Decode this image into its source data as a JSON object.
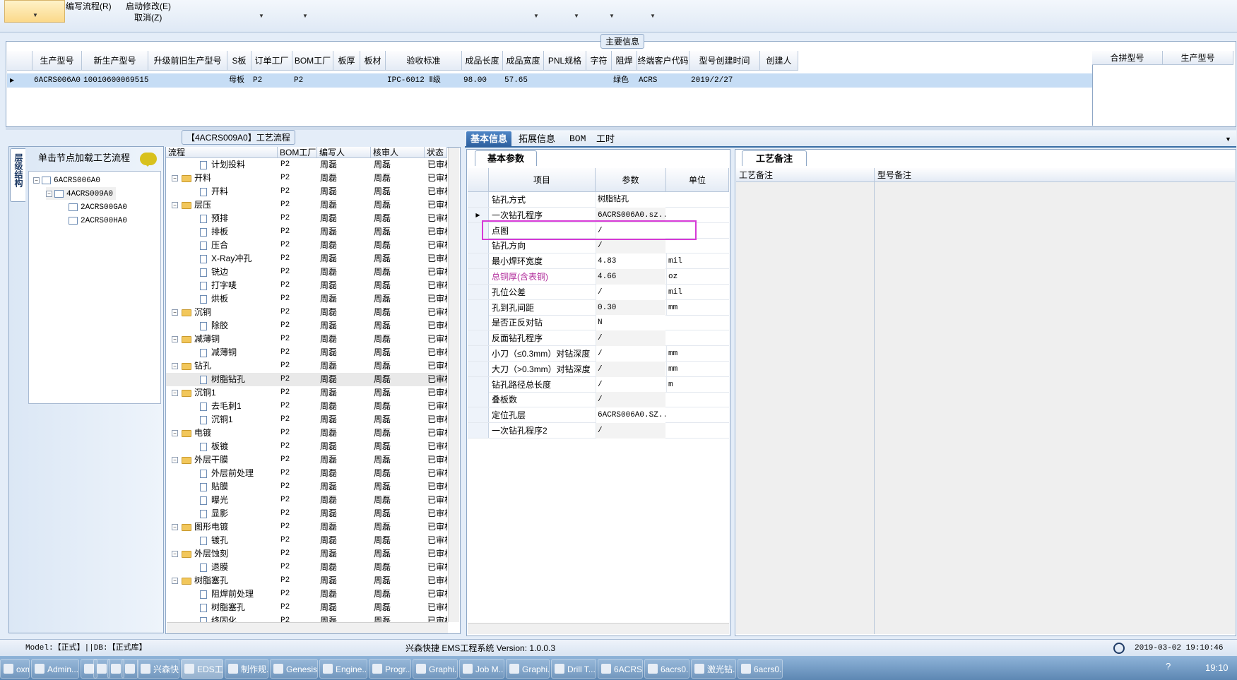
{
  "ribbon": {
    "menu1": "编写流程(R)",
    "menu2": "启动修改(E)",
    "menu3": "取消(Z)"
  },
  "main_info": {
    "title": "主要信息",
    "columns": [
      "生产型号",
      "新生产型号",
      "升级前旧生产型号",
      "S板",
      "订单工厂",
      "BOM工厂",
      "板厚",
      "板材",
      "验收标准",
      "成品长度",
      "成品宽度",
      "PNL规格",
      "字符",
      "阻焊",
      "终端客户代码",
      "型号创建时间",
      "创建人"
    ],
    "row": [
      "6ACRS006A0",
      "10010600069515",
      "",
      "母板",
      "P2",
      "P2",
      "",
      "",
      "IPC-6012 Ⅱ级",
      "98.00",
      "57.65",
      "",
      "",
      "绿色",
      "ACRS",
      "2019/2/27",
      ""
    ],
    "side_columns": [
      "合拼型号",
      "生产型号"
    ]
  },
  "nav": {
    "vtab": "层级结构",
    "header": "单击节点加载工艺流程",
    "nodes": [
      "6ACRS006A0",
      "4ACRS009A0",
      "2ACRS00GA0",
      "2ACRS00HA0"
    ]
  },
  "process": {
    "title": "【4ACRS009A0】工艺流程",
    "columns": [
      "流程",
      "BOM工厂",
      "编写人",
      "核审人",
      "状态"
    ],
    "rows": [
      {
        "name": "计划投料",
        "level": 2,
        "bom": "P2",
        "writer": "周磊",
        "reviewer": "周磊",
        "status": "已审核"
      },
      {
        "name": "开料",
        "level": 1,
        "bom": "P2",
        "writer": "周磊",
        "reviewer": "周磊",
        "status": "已审核"
      },
      {
        "name": "开料",
        "level": 2,
        "bom": "P2",
        "writer": "周磊",
        "reviewer": "周磊",
        "status": "已审核"
      },
      {
        "name": "层压",
        "level": 1,
        "bom": "P2",
        "writer": "周磊",
        "reviewer": "周磊",
        "status": "已审核"
      },
      {
        "name": "预排",
        "level": 2,
        "bom": "P2",
        "writer": "周磊",
        "reviewer": "周磊",
        "status": "已审核"
      },
      {
        "name": "排板",
        "level": 2,
        "bom": "P2",
        "writer": "周磊",
        "reviewer": "周磊",
        "status": "已审核"
      },
      {
        "name": "压合",
        "level": 2,
        "bom": "P2",
        "writer": "周磊",
        "reviewer": "周磊",
        "status": "已审核"
      },
      {
        "name": "X-Ray冲孔",
        "level": 2,
        "bom": "P2",
        "writer": "周磊",
        "reviewer": "周磊",
        "status": "已审核"
      },
      {
        "name": "铣边",
        "level": 2,
        "bom": "P2",
        "writer": "周磊",
        "reviewer": "周磊",
        "status": "已审核"
      },
      {
        "name": "打字唛",
        "level": 2,
        "bom": "P2",
        "writer": "周磊",
        "reviewer": "周磊",
        "status": "已审核"
      },
      {
        "name": "烘板",
        "level": 2,
        "bom": "P2",
        "writer": "周磊",
        "reviewer": "周磊",
        "status": "已审核"
      },
      {
        "name": "沉铜",
        "level": 1,
        "bom": "P2",
        "writer": "周磊",
        "reviewer": "周磊",
        "status": "已审核"
      },
      {
        "name": "除胶",
        "level": 2,
        "bom": "P2",
        "writer": "周磊",
        "reviewer": "周磊",
        "status": "已审核"
      },
      {
        "name": "减薄铜",
        "level": 1,
        "bom": "P2",
        "writer": "周磊",
        "reviewer": "周磊",
        "status": "已审核"
      },
      {
        "name": "减薄铜",
        "level": 2,
        "bom": "P2",
        "writer": "周磊",
        "reviewer": "周磊",
        "status": "已审核"
      },
      {
        "name": "钻孔",
        "level": 1,
        "bom": "P2",
        "writer": "周磊",
        "reviewer": "周磊",
        "status": "已审核"
      },
      {
        "name": "树脂钻孔",
        "level": 2,
        "bom": "P2",
        "writer": "周磊",
        "reviewer": "周磊",
        "status": "已审核"
      },
      {
        "name": "沉铜1",
        "level": 1,
        "bom": "P2",
        "writer": "周磊",
        "reviewer": "周磊",
        "status": "已审核"
      },
      {
        "name": "去毛刺1",
        "level": 2,
        "bom": "P2",
        "writer": "周磊",
        "reviewer": "周磊",
        "status": "已审核"
      },
      {
        "name": "沉铜1",
        "level": 2,
        "bom": "P2",
        "writer": "周磊",
        "reviewer": "周磊",
        "status": "已审核"
      },
      {
        "name": "电镀",
        "level": 1,
        "bom": "P2",
        "writer": "周磊",
        "reviewer": "周磊",
        "status": "已审核"
      },
      {
        "name": "板镀",
        "level": 2,
        "bom": "P2",
        "writer": "周磊",
        "reviewer": "周磊",
        "status": "已审核"
      },
      {
        "name": "外层干膜",
        "level": 1,
        "bom": "P2",
        "writer": "周磊",
        "reviewer": "周磊",
        "status": "已审核"
      },
      {
        "name": "外层前处理",
        "level": 2,
        "bom": "P2",
        "writer": "周磊",
        "reviewer": "周磊",
        "status": "已审核"
      },
      {
        "name": "贴膜",
        "level": 2,
        "bom": "P2",
        "writer": "周磊",
        "reviewer": "周磊",
        "status": "已审核"
      },
      {
        "name": "曝光",
        "level": 2,
        "bom": "P2",
        "writer": "周磊",
        "reviewer": "周磊",
        "status": "已审核"
      },
      {
        "name": "显影",
        "level": 2,
        "bom": "P2",
        "writer": "周磊",
        "reviewer": "周磊",
        "status": "已审核"
      },
      {
        "name": "图形电镀",
        "level": 1,
        "bom": "P2",
        "writer": "周磊",
        "reviewer": "周磊",
        "status": "已审核"
      },
      {
        "name": "镀孔",
        "level": 2,
        "bom": "P2",
        "writer": "周磊",
        "reviewer": "周磊",
        "status": "已审核"
      },
      {
        "name": "外层蚀刻",
        "level": 1,
        "bom": "P2",
        "writer": "周磊",
        "reviewer": "周磊",
        "status": "已审核"
      },
      {
        "name": "退膜",
        "level": 2,
        "bom": "P2",
        "writer": "周磊",
        "reviewer": "周磊",
        "status": "已审核"
      },
      {
        "name": "树脂塞孔",
        "level": 1,
        "bom": "P2",
        "writer": "周磊",
        "reviewer": "周磊",
        "status": "已审核"
      },
      {
        "name": "阻焊前处理",
        "level": 2,
        "bom": "P2",
        "writer": "周磊",
        "reviewer": "周磊",
        "status": "已审核"
      },
      {
        "name": "树脂塞孔",
        "level": 2,
        "bom": "P2",
        "writer": "周磊",
        "reviewer": "周磊",
        "status": "已审核"
      },
      {
        "name": "终固化",
        "level": 2,
        "bom": "P2",
        "writer": "周磊",
        "reviewer": "周磊",
        "status": "已审核"
      }
    ]
  },
  "tabs": [
    "基本信息",
    "拓展信息",
    "BOM",
    "工时"
  ],
  "basic": {
    "tab": "基本参数",
    "columns": [
      "项目",
      "参数",
      "单位"
    ],
    "rows": [
      {
        "k": "钻孔方式",
        "v": "树脂钻孔",
        "u": ""
      },
      {
        "k": "一次钻孔程序",
        "v": "6ACRS006A0.sz...",
        "u": ""
      },
      {
        "k": "点图",
        "v": "/",
        "u": ""
      },
      {
        "k": "钻孔方向",
        "v": "/",
        "u": ""
      },
      {
        "k": "最小焊环宽度",
        "v": "4.83",
        "u": "mil"
      },
      {
        "k": "总铜厚(含表铜)",
        "v": "4.66",
        "u": "oz"
      },
      {
        "k": "孔位公差",
        "v": "/",
        "u": "mil"
      },
      {
        "k": "孔到孔间距",
        "v": "0.30",
        "u": "mm"
      },
      {
        "k": "是否正反对钻",
        "v": "N",
        "u": ""
      },
      {
        "k": "反面钻孔程序",
        "v": "/",
        "u": ""
      },
      {
        "k": "小刀（≤0.3mm）对钻深度",
        "v": "/",
        "u": "mm"
      },
      {
        "k": "大刀（>0.3mm）对钻深度",
        "v": "/",
        "u": "mm"
      },
      {
        "k": "钻孔路径总长度",
        "v": "/",
        "u": "m"
      },
      {
        "k": "叠板数",
        "v": "/",
        "u": ""
      },
      {
        "k": "定位孔层",
        "v": "6ACRS006A0.SZ...",
        "u": ""
      },
      {
        "k": "一次钻孔程序2",
        "v": "/",
        "u": ""
      }
    ]
  },
  "remarks": {
    "tab": "工艺备注",
    "col1": "工艺备注",
    "col2": "型号备注"
  },
  "status": {
    "left": "Model:【正式】||DB:【正式库】",
    "center": "兴森快捷 EMS工程系统 Version: 1.0.0.3",
    "datetime": "2019-03-02 19:10:46"
  },
  "taskbar": {
    "items": [
      "oxmail",
      "Admin...",
      "",
      "",
      "",
      "",
      "兴森快...",
      "EDS工...",
      "制作规...",
      "Genesis",
      "Engine...",
      "Progr...",
      "Graphi...",
      "Job M...",
      "Graphi...",
      "Drill T...",
      "6ACRS...",
      "6acrs0...",
      "激光钻...",
      "6acrs0..."
    ],
    "clock": "19:10"
  },
  "colors": {
    "accent": "#2d5f9e",
    "highlight": "#d63ad6",
    "selected_row": "#c6ddf5",
    "magenta_text": "#b02a9a"
  }
}
